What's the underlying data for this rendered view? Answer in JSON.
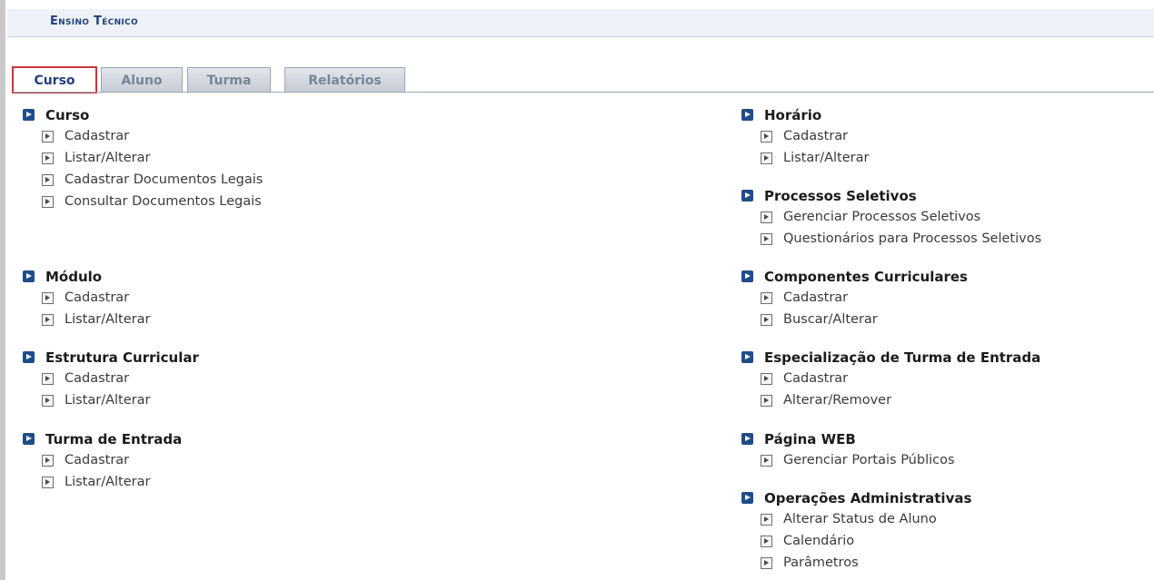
{
  "header": {
    "title": "Ensino Técnico"
  },
  "tabs": [
    {
      "label": "Curso",
      "active": true
    },
    {
      "label": "Aluno",
      "active": false
    },
    {
      "label": "Turma",
      "active": false
    },
    {
      "label": "Relatórios",
      "active": false
    }
  ],
  "left": {
    "curso": {
      "title": "Curso",
      "items": [
        "Cadastrar",
        "Listar/Alterar",
        "Cadastrar Documentos Legais",
        "Consultar Documentos Legais"
      ]
    },
    "modulo": {
      "title": "Módulo",
      "items": [
        "Cadastrar",
        "Listar/Alterar"
      ]
    },
    "estrutura": {
      "title": "Estrutura Curricular",
      "items": [
        "Cadastrar",
        "Listar/Alterar"
      ]
    },
    "turma_entrada": {
      "title": "Turma de Entrada",
      "items": [
        "Cadastrar",
        "Listar/Alterar"
      ]
    }
  },
  "right": {
    "horario": {
      "title": "Horário",
      "items": [
        "Cadastrar",
        "Listar/Alterar"
      ]
    },
    "processos": {
      "title": "Processos Seletivos",
      "items": [
        "Gerenciar Processos Seletivos",
        "Questionários para Processos Seletivos"
      ]
    },
    "componentes": {
      "title": "Componentes Curriculares",
      "items": [
        "Cadastrar",
        "Buscar/Alterar"
      ]
    },
    "especializacao": {
      "title": "Especialização de Turma de Entrada",
      "items": [
        "Cadastrar",
        "Alterar/Remover"
      ]
    },
    "pagina_web": {
      "title": "Página WEB",
      "items": [
        "Gerenciar Portais Públicos"
      ]
    },
    "operacoes": {
      "title": "Operações Administrativas",
      "items": [
        "Alterar Status de Aluno",
        "Calendário",
        "Parâmetros"
      ]
    }
  },
  "colors": {
    "accent": "#1f3f7a",
    "active_tab_border": "#c0393b",
    "bullet": "#1f4d8a"
  }
}
